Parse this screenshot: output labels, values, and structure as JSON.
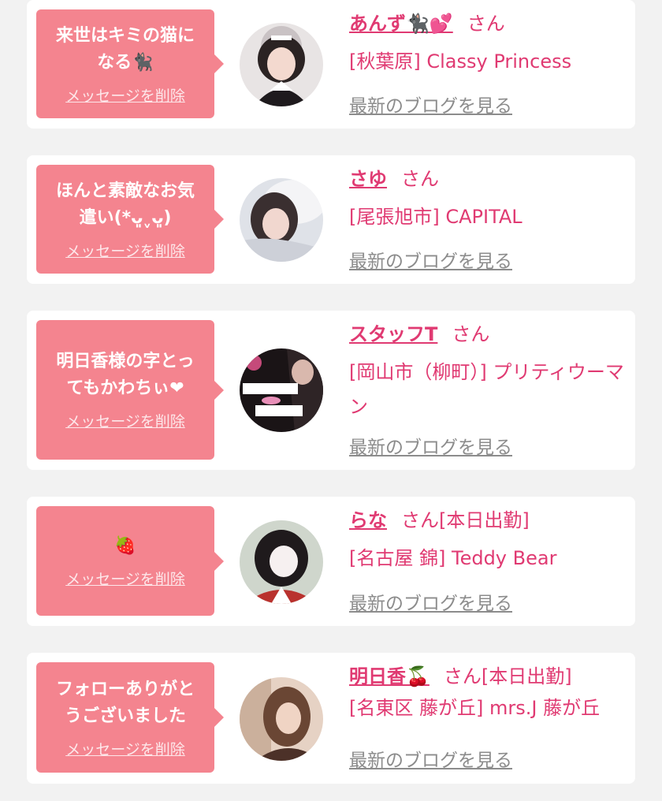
{
  "colors": {
    "bubble": "#f4848f",
    "accent": "#e03a72",
    "link_gray": "#8c8c8c",
    "background": "#f2f2f2"
  },
  "messages": [
    {
      "message": "来世はキミの猫に\nなる🐈‍⬛",
      "delete_label": "メッセージを削除",
      "name": "あんず🐈‍⬛💕",
      "honorific": "さん",
      "status": "",
      "shop": "[秋葉原] Classy Princess",
      "blog_label": "最新のブログを見る",
      "avatar_icon": "maid-girl-photo-icon"
    },
    {
      "message": "ほんと素敵なお気\n遣い(*ᴗ͈ˬᴗ͈)",
      "delete_label": "メッセージを削除",
      "name": "さゆ",
      "honorific": "さん",
      "status": "",
      "shop": "[尾張旭市] CAPITAL",
      "blog_label": "最新のブログを見る",
      "avatar_icon": "girl-pillow-photo-icon"
    },
    {
      "message": "明日香様の字とっ\nてもかわちぃ❤",
      "delete_label": "メッセージを削除",
      "name": "スタッフT",
      "honorific": "さん",
      "status": "",
      "shop": "[岡山市（柳町）] プリティウーマン",
      "blog_label": "最新のブログを見る",
      "avatar_icon": "pretty-woman-logo-icon"
    },
    {
      "message": "🍓",
      "delete_label": "メッセージを削除",
      "name": "らな",
      "honorific": "さん",
      "status": "[本日出勤]",
      "shop": "[名古屋 錦] Teddy Bear",
      "blog_label": "最新のブログを見る",
      "avatar_icon": "girl-selfie-photo-icon"
    },
    {
      "message": "フォローありがと\nうございました",
      "delete_label": "メッセージを削除",
      "name": "明日香🍒",
      "honorific": "さん",
      "status": "[本日出勤]",
      "shop": "[名東区 藤が丘] mrs.J 藤が丘",
      "blog_label": "最新のブログを見る",
      "avatar_icon": "woman-portrait-photo-icon"
    }
  ]
}
